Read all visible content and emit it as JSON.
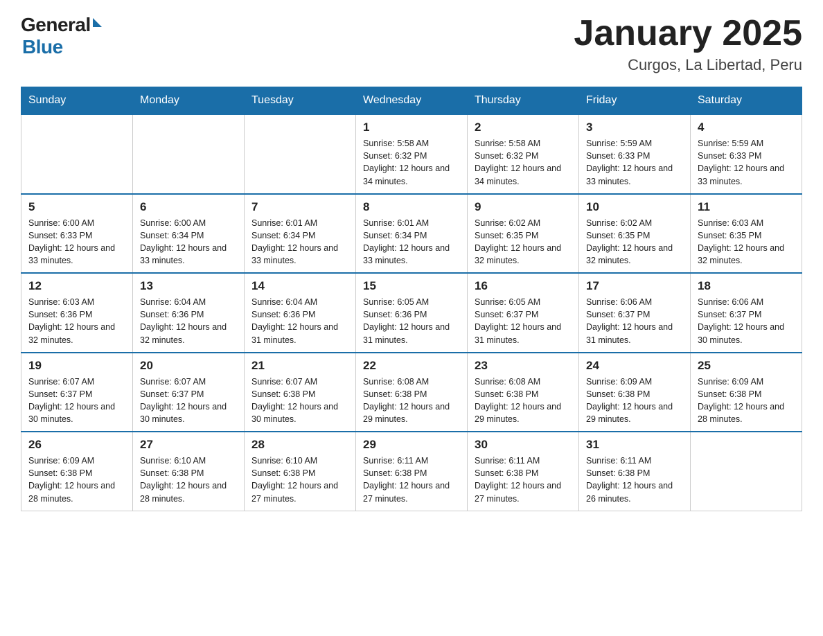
{
  "header": {
    "logo_general": "General",
    "logo_blue": "Blue",
    "title": "January 2025",
    "location": "Curgos, La Libertad, Peru"
  },
  "days_of_week": [
    "Sunday",
    "Monday",
    "Tuesday",
    "Wednesday",
    "Thursday",
    "Friday",
    "Saturday"
  ],
  "weeks": [
    [
      {
        "day": "",
        "info": ""
      },
      {
        "day": "",
        "info": ""
      },
      {
        "day": "",
        "info": ""
      },
      {
        "day": "1",
        "info": "Sunrise: 5:58 AM\nSunset: 6:32 PM\nDaylight: 12 hours\nand 34 minutes."
      },
      {
        "day": "2",
        "info": "Sunrise: 5:58 AM\nSunset: 6:32 PM\nDaylight: 12 hours\nand 34 minutes."
      },
      {
        "day": "3",
        "info": "Sunrise: 5:59 AM\nSunset: 6:33 PM\nDaylight: 12 hours\nand 33 minutes."
      },
      {
        "day": "4",
        "info": "Sunrise: 5:59 AM\nSunset: 6:33 PM\nDaylight: 12 hours\nand 33 minutes."
      }
    ],
    [
      {
        "day": "5",
        "info": "Sunrise: 6:00 AM\nSunset: 6:33 PM\nDaylight: 12 hours\nand 33 minutes."
      },
      {
        "day": "6",
        "info": "Sunrise: 6:00 AM\nSunset: 6:34 PM\nDaylight: 12 hours\nand 33 minutes."
      },
      {
        "day": "7",
        "info": "Sunrise: 6:01 AM\nSunset: 6:34 PM\nDaylight: 12 hours\nand 33 minutes."
      },
      {
        "day": "8",
        "info": "Sunrise: 6:01 AM\nSunset: 6:34 PM\nDaylight: 12 hours\nand 33 minutes."
      },
      {
        "day": "9",
        "info": "Sunrise: 6:02 AM\nSunset: 6:35 PM\nDaylight: 12 hours\nand 32 minutes."
      },
      {
        "day": "10",
        "info": "Sunrise: 6:02 AM\nSunset: 6:35 PM\nDaylight: 12 hours\nand 32 minutes."
      },
      {
        "day": "11",
        "info": "Sunrise: 6:03 AM\nSunset: 6:35 PM\nDaylight: 12 hours\nand 32 minutes."
      }
    ],
    [
      {
        "day": "12",
        "info": "Sunrise: 6:03 AM\nSunset: 6:36 PM\nDaylight: 12 hours\nand 32 minutes."
      },
      {
        "day": "13",
        "info": "Sunrise: 6:04 AM\nSunset: 6:36 PM\nDaylight: 12 hours\nand 32 minutes."
      },
      {
        "day": "14",
        "info": "Sunrise: 6:04 AM\nSunset: 6:36 PM\nDaylight: 12 hours\nand 31 minutes."
      },
      {
        "day": "15",
        "info": "Sunrise: 6:05 AM\nSunset: 6:36 PM\nDaylight: 12 hours\nand 31 minutes."
      },
      {
        "day": "16",
        "info": "Sunrise: 6:05 AM\nSunset: 6:37 PM\nDaylight: 12 hours\nand 31 minutes."
      },
      {
        "day": "17",
        "info": "Sunrise: 6:06 AM\nSunset: 6:37 PM\nDaylight: 12 hours\nand 31 minutes."
      },
      {
        "day": "18",
        "info": "Sunrise: 6:06 AM\nSunset: 6:37 PM\nDaylight: 12 hours\nand 30 minutes."
      }
    ],
    [
      {
        "day": "19",
        "info": "Sunrise: 6:07 AM\nSunset: 6:37 PM\nDaylight: 12 hours\nand 30 minutes."
      },
      {
        "day": "20",
        "info": "Sunrise: 6:07 AM\nSunset: 6:37 PM\nDaylight: 12 hours\nand 30 minutes."
      },
      {
        "day": "21",
        "info": "Sunrise: 6:07 AM\nSunset: 6:38 PM\nDaylight: 12 hours\nand 30 minutes."
      },
      {
        "day": "22",
        "info": "Sunrise: 6:08 AM\nSunset: 6:38 PM\nDaylight: 12 hours\nand 29 minutes."
      },
      {
        "day": "23",
        "info": "Sunrise: 6:08 AM\nSunset: 6:38 PM\nDaylight: 12 hours\nand 29 minutes."
      },
      {
        "day": "24",
        "info": "Sunrise: 6:09 AM\nSunset: 6:38 PM\nDaylight: 12 hours\nand 29 minutes."
      },
      {
        "day": "25",
        "info": "Sunrise: 6:09 AM\nSunset: 6:38 PM\nDaylight: 12 hours\nand 28 minutes."
      }
    ],
    [
      {
        "day": "26",
        "info": "Sunrise: 6:09 AM\nSunset: 6:38 PM\nDaylight: 12 hours\nand 28 minutes."
      },
      {
        "day": "27",
        "info": "Sunrise: 6:10 AM\nSunset: 6:38 PM\nDaylight: 12 hours\nand 28 minutes."
      },
      {
        "day": "28",
        "info": "Sunrise: 6:10 AM\nSunset: 6:38 PM\nDaylight: 12 hours\nand 27 minutes."
      },
      {
        "day": "29",
        "info": "Sunrise: 6:11 AM\nSunset: 6:38 PM\nDaylight: 12 hours\nand 27 minutes."
      },
      {
        "day": "30",
        "info": "Sunrise: 6:11 AM\nSunset: 6:38 PM\nDaylight: 12 hours\nand 27 minutes."
      },
      {
        "day": "31",
        "info": "Sunrise: 6:11 AM\nSunset: 6:38 PM\nDaylight: 12 hours\nand 26 minutes."
      },
      {
        "day": "",
        "info": ""
      }
    ]
  ]
}
